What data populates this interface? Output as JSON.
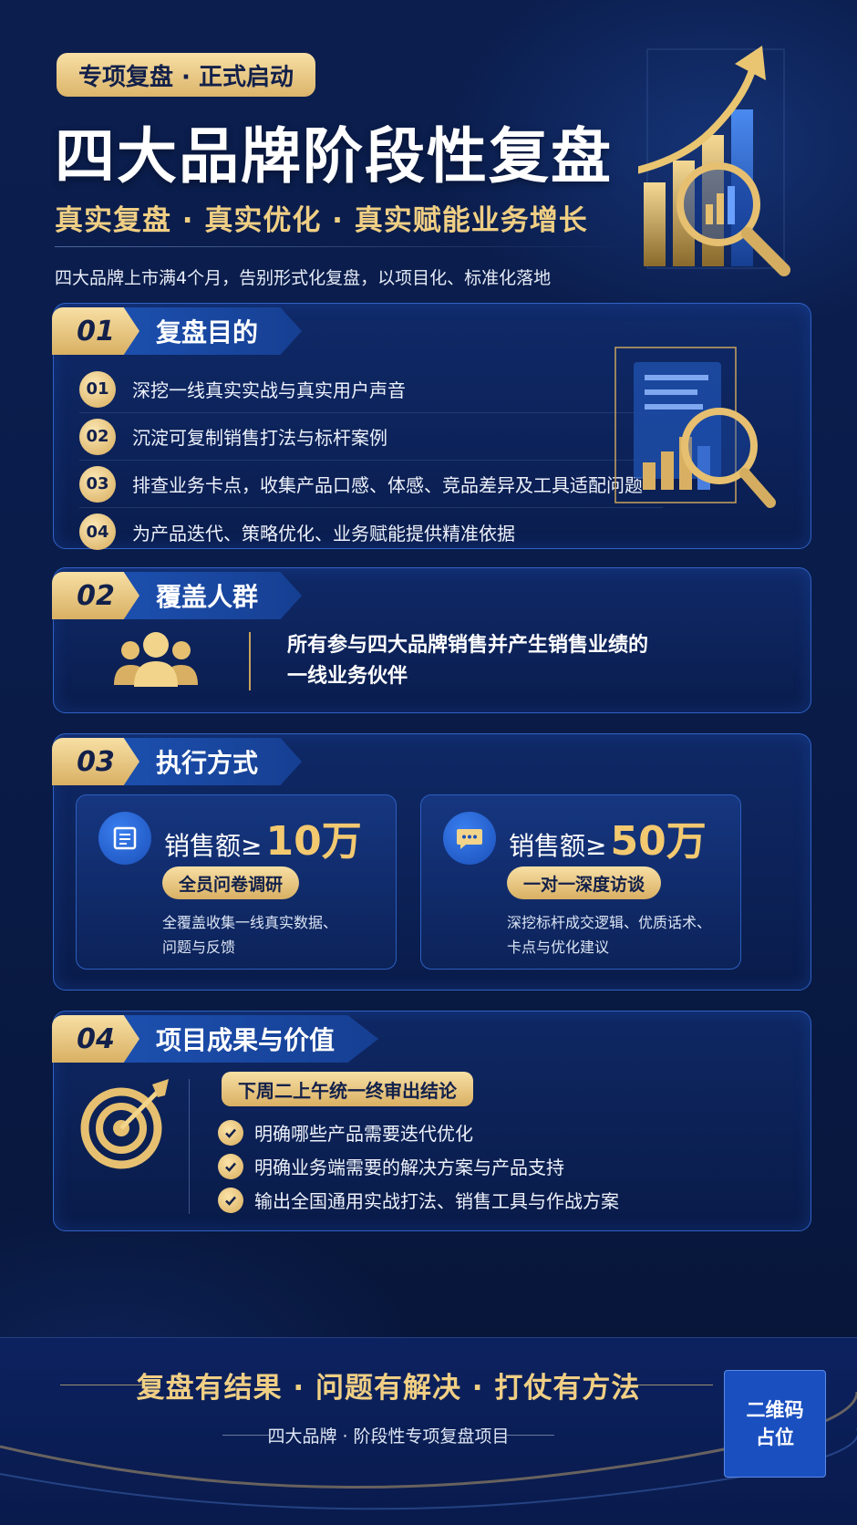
{
  "header": {
    "tag": "专项复盘 · 正式启动",
    "title": "四大品牌阶段性复盘",
    "subtitle": "真实复盘 · 真实优化 · 真实赋能业务增长",
    "intro": "四大品牌上市满4个月，告别形式化复盘，以项目化、标准化落地"
  },
  "sections": {
    "purpose": {
      "num": "01",
      "title": "复盘目的",
      "items": [
        {
          "num": "01",
          "text": "深挖一线真实实战与真实用户声音"
        },
        {
          "num": "02",
          "text": "沉淀可复制销售打法与标杆案例"
        },
        {
          "num": "03",
          "text": "排查业务卡点，收集产品口感、体感、竞品差异及工具适配问题"
        },
        {
          "num": "04",
          "text": "为产品迭代、策略优化、业务赋能提供精准依据"
        }
      ]
    },
    "audience": {
      "num": "02",
      "title": "覆盖人群",
      "line1": "所有参与四大品牌销售并产生销售业绩的",
      "line2": "一线业务伙伴"
    },
    "method": {
      "num": "03",
      "title": "执行方式",
      "options": [
        {
          "label": "销售额≥",
          "amount": "10万",
          "pill": "全员问卷调研",
          "desc1": "全覆盖收集一线真实数据、",
          "desc2": "问题与反馈",
          "icon": "document-icon"
        },
        {
          "label": "销售额≥",
          "amount": "50万",
          "pill": "一对一深度访谈",
          "desc1": "深挖标杆成交逻辑、优质话术、",
          "desc2": "卡点与优化建议",
          "icon": "chat-icon"
        }
      ]
    },
    "results": {
      "num": "04",
      "title": "项目成果与价值",
      "pill": "下周二上午统一终审出结论",
      "items": [
        "明确哪些产品需要迭代优化",
        "明确业务端需要的解决方案与产品支持",
        "输出全国通用实战打法、销售工具与作战方案"
      ]
    }
  },
  "footer": {
    "slogan": "复盘有结果 · 问题有解决 · 打仗有方法",
    "sub": "四大品牌 · 阶段性专项复盘项目",
    "qr_line1": "二维码",
    "qr_line2": "占位"
  },
  "colors": {
    "background": "#0b1e4e",
    "gold": "#f0cf84",
    "accent_blue": "#1c4fae"
  }
}
